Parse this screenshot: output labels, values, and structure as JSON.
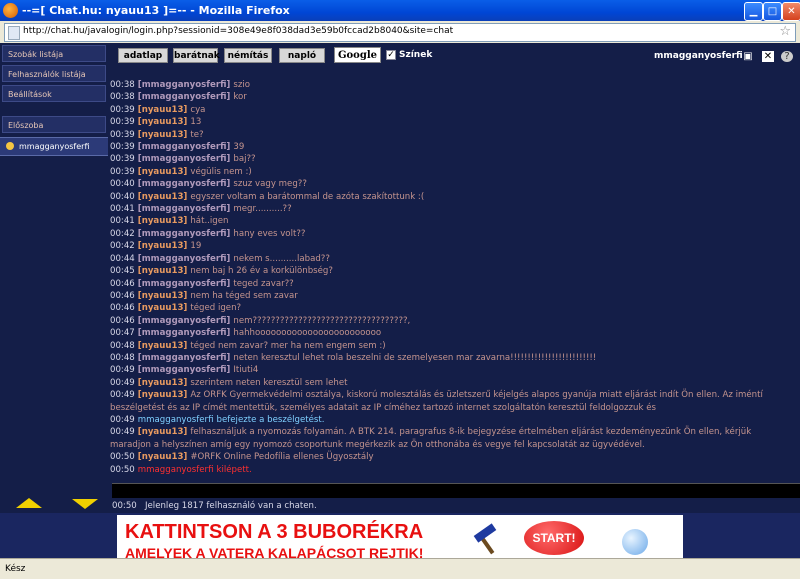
{
  "window": {
    "title": "--=[ Chat.hu: nyauu13 ]=-- - Mozilla Firefox"
  },
  "address": {
    "url": "http://chat.hu/javalogin/login.php?sessionid=308e49e8f038dad3e59b0fccad2b8040&site=chat"
  },
  "sidebar": {
    "items": [
      {
        "label": "Szobák listája"
      },
      {
        "label": "Felhasználók listája"
      },
      {
        "label": "Beállítások"
      },
      {
        "label": "Előszoba"
      }
    ],
    "user": "mmagganyosferfi"
  },
  "toolbar": {
    "buttons": [
      "adatlap",
      "barátnak",
      "némítás",
      "napló"
    ],
    "google": "Google",
    "colors_label": "Színek",
    "username": "mmagganyosferfi"
  },
  "messages": [
    {
      "time": "00:38",
      "nick": "[mmagganyosferfi]",
      "text": "szio"
    },
    {
      "time": "00:38",
      "nick": "[mmagganyosferfi]",
      "text": "kor"
    },
    {
      "time": "00:39",
      "nick": "[nyauu13]",
      "text": "cya"
    },
    {
      "time": "00:39",
      "nick": "[nyauu13]",
      "text": "13"
    },
    {
      "time": "00:39",
      "nick": "[nyauu13]",
      "text": "te?"
    },
    {
      "time": "00:39",
      "nick": "[mmagganyosferfi]",
      "text": "39"
    },
    {
      "time": "00:39",
      "nick": "[mmagganyosferfi]",
      "text": "baj??"
    },
    {
      "time": "00:39",
      "nick": "[nyauu13]",
      "text": "végülis nem :)"
    },
    {
      "time": "00:40",
      "nick": "[mmagganyosferfi]",
      "text": "szuz vagy meg??"
    },
    {
      "time": "00:40",
      "nick": "[nyauu13]",
      "text": "egyszer voltam a barátommal de azóta szakítottunk :("
    },
    {
      "time": "00:41",
      "nick": "[mmagganyosferfi]",
      "text": "megr..........??"
    },
    {
      "time": "00:41",
      "nick": "[nyauu13]",
      "text": "hát..igen"
    },
    {
      "time": "00:42",
      "nick": "[mmagganyosferfi]",
      "text": "hany eves volt??"
    },
    {
      "time": "00:42",
      "nick": "[nyauu13]",
      "text": "19"
    },
    {
      "time": "00:44",
      "nick": "[mmagganyosferfi]",
      "text": "nekem s..........labad??"
    },
    {
      "time": "00:45",
      "nick": "[nyauu13]",
      "text": "nem baj h 26 év a korkülönbség?"
    },
    {
      "time": "00:46",
      "nick": "[mmagganyosferfi]",
      "text": "teged zavar??"
    },
    {
      "time": "00:46",
      "nick": "[nyauu13]",
      "text": "nem ha téged sem zavar"
    },
    {
      "time": "00:46",
      "nick": "[nyauu13]",
      "text": "téged igen?"
    },
    {
      "time": "00:46",
      "nick": "[mmagganyosferfi]",
      "text": "nem??????????????????????????????????,"
    },
    {
      "time": "00:47",
      "nick": "[mmagganyosferfi]",
      "text": "hahhoooooooooooooooooooooooo"
    },
    {
      "time": "00:48",
      "nick": "[nyauu13]",
      "text": "téged nem zavar? mer ha nem engem sem :)"
    },
    {
      "time": "00:48",
      "nick": "[mmagganyosferfi]",
      "text": "neten keresztul lehet rola beszelni de szemelyesen mar zavarna!!!!!!!!!!!!!!!!!!!!!!!!!"
    },
    {
      "time": "00:49",
      "nick": "[mmagganyosferfi]",
      "text": "Itiuti4"
    },
    {
      "time": "00:49",
      "nick": "[nyauu13]",
      "text": "szerintem neten keresztül sem lehet"
    },
    {
      "time": "00:49",
      "nick": "[nyauu13]",
      "text": "Az ORFK Gyermekvédelmi osztálya, kiskorú molesztálás és üzletszerű kéjelgés alapos gyanúja miatt eljárást indít Ön ellen. Az iméntí beszélgetést és az IP címét mentettük, személyes adatait az IP címéhez tartozó internet szolgáltatón keresztül feldolgozzuk és",
      "wrap": true
    },
    {
      "time": "00:49",
      "nick": "mmagganyosferfi",
      "text": "befejezte a beszélgetést.",
      "kind": "sys"
    },
    {
      "time": "00:49",
      "nick": "[nyauu13]",
      "text": "felhasználjuk a nyomozás folyamán. A BTK 214. paragrafus 8-ik bejegyzése értelmében eljárást kezdeményezünk Ön ellen, kérjük maradjon a helyszínen amíg egy nyomozó csoportunk megérkezik az Ön otthonába és vegye fel kapcsolatát az ügyvédével.",
      "wrap": true
    },
    {
      "time": "00:50",
      "nick": "[nyauu13]",
      "text": "#ORFK Online Pedofília ellenes Ügyosztály"
    },
    {
      "time": "00:50",
      "nick": "mmagganyosferfi",
      "text": "kilépett.",
      "kind": "sysr"
    }
  ],
  "status_line": {
    "time": "00:50",
    "text": "Jelenleg 1817 felhasználó van a chaten."
  },
  "banner": {
    "line1": "KATTINTSON A 3 BUBORÉKRA",
    "line2": "AMELYEK A VATERA KALAPÁCSOT REJTIK!",
    "start": "START!"
  },
  "statusbar": {
    "text": "Kész"
  }
}
